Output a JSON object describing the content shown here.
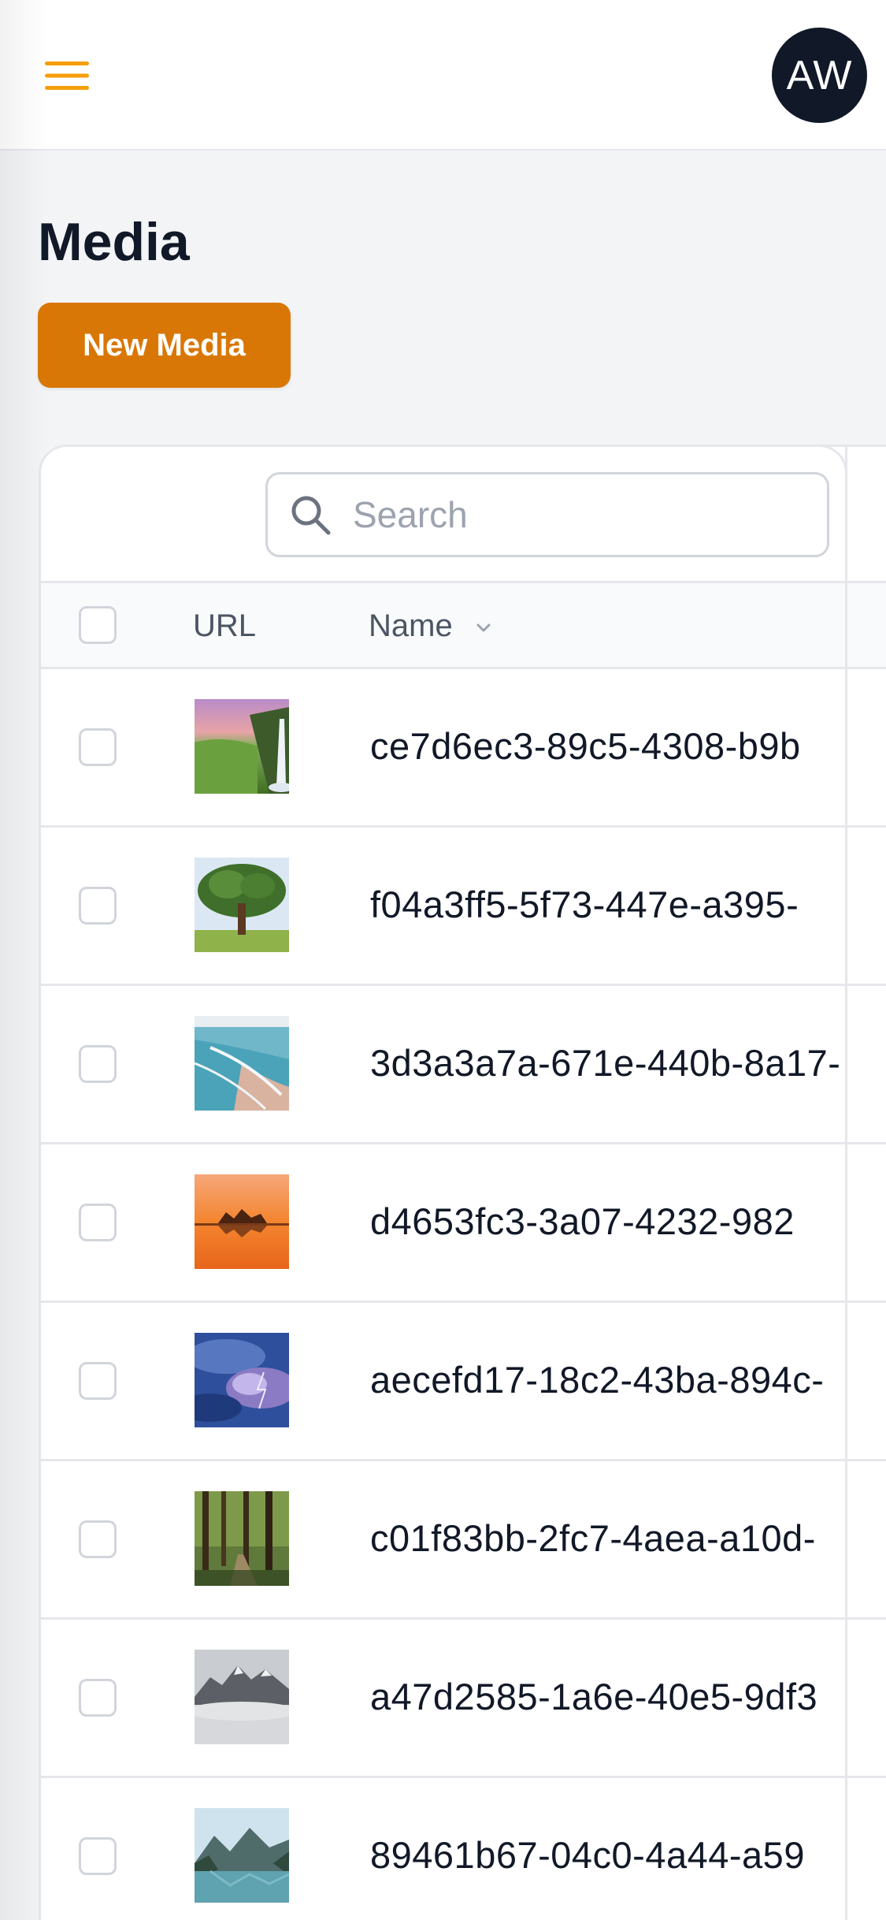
{
  "header": {
    "menu_icon": "hamburger-icon",
    "avatar_initials": "AW",
    "accent_color": "#d97706"
  },
  "page": {
    "title": "Media",
    "new_button_label": "New Media"
  },
  "search": {
    "placeholder": "Search",
    "value": ""
  },
  "table": {
    "columns": [
      "URL",
      "Name"
    ],
    "sort_column": "Name",
    "rows": [
      {
        "name": "ce7d6ec3-89c5-4308-b9b",
        "thumbnail": "waterfall-meadow-thumbnail"
      },
      {
        "name": "f04a3ff5-5f73-447e-a395-",
        "thumbnail": "lone-tree-thumbnail"
      },
      {
        "name": "3d3a3a7a-671e-440b-8a17-",
        "thumbnail": "beach-waves-thumbnail"
      },
      {
        "name": "d4653fc3-3a07-4232-982",
        "thumbnail": "orange-sunset-lake-thumbnail"
      },
      {
        "name": "aecefd17-18c2-43ba-894c-",
        "thumbnail": "storm-clouds-thumbnail"
      },
      {
        "name": "c01f83bb-2fc7-4aea-a10d-",
        "thumbnail": "forest-path-thumbnail"
      },
      {
        "name": "a47d2585-1a6e-40e5-9df3",
        "thumbnail": "misty-mountains-thumbnail"
      },
      {
        "name": "89461b67-04c0-4a44-a59",
        "thumbnail": "mountain-lake-thumbnail"
      }
    ]
  }
}
